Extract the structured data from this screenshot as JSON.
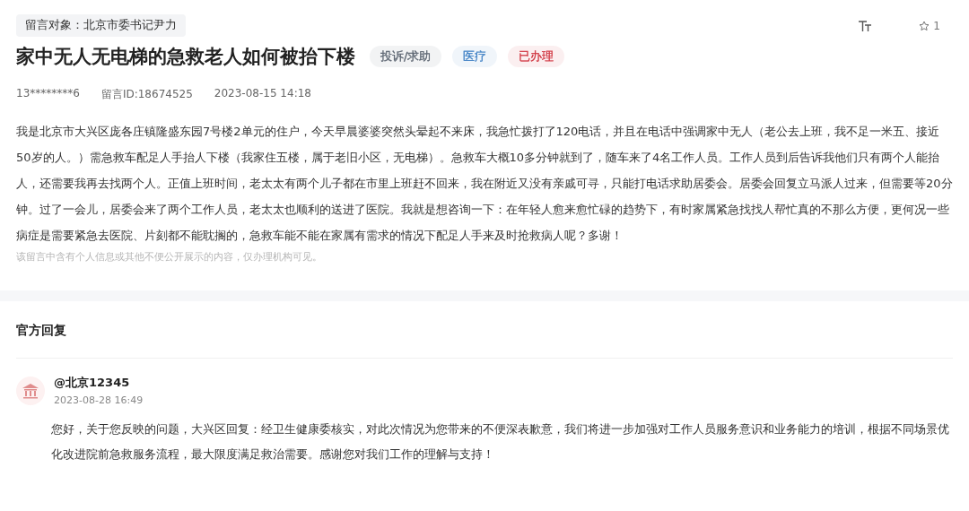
{
  "recipient": "留言对象：北京市委书记尹力",
  "favorite_count": "1",
  "title": "家中无人无电梯的急救老人如何被抬下楼",
  "tags": [
    {
      "label": "投诉/求助",
      "color": "#5b6470"
    },
    {
      "label": "医疗",
      "color": "#3d7fc4"
    },
    {
      "label": "已办理",
      "color": "#d0343f"
    }
  ],
  "meta": {
    "user": "13********6",
    "message_id": "留言ID:18674525",
    "time": "2023-08-15 14:18"
  },
  "message": "我是北京市大兴区庞各庄镇隆盛东园7号楼2单元的住户，今天早晨婆婆突然头晕起不来床，我急忙拨打了120电话，并且在电话中强调家中无人（老公去上班，我不足一米五、接近50岁的人。）需急救车配足人手抬人下楼（我家住五楼，属于老旧小区，无电梯）。急救车大概10多分钟就到了，随车来了4名工作人员。工作人员到后告诉我他们只有两个人能抬人，还需要我再去找两个人。正值上班时间，老太太有两个儿子都在市里上班赶不回来，我在附近又没有亲戚可寻，只能打电话求助居委会。居委会回复立马派人过来，但需要等20分钟。过了一会儿，居委会来了两个工作人员，老太太也顺利的送进了医院。我就是想咨询一下：在年轻人愈来愈忙碌的趋势下，有时家属紧急找找人帮忙真的不那么方便，更何况一些病症是需要紧急去医院、片刻都不能耽搁的，急救车能不能在家属有需求的情况下配足人手来及时抢救病人呢？多谢！",
  "privacy_note": "该留言中含有个人信息或其他不便公开展示的内容，仅办理机构可见。",
  "reply_section": {
    "heading": "官方回复",
    "reply": {
      "author": "@北京12345",
      "time": "2023-08-28 16:49",
      "text": "您好，关于您反映的问题，大兴区回复：经卫生健康委核实，对此次情况为您带来的不便深表歉意，我们将进一步加强对工作人员服务意识和业务能力的培训，根据不同场景优化改进院前急救服务流程，最大限度满足救治需要。感谢您对我们工作的理解与支持！"
    }
  }
}
